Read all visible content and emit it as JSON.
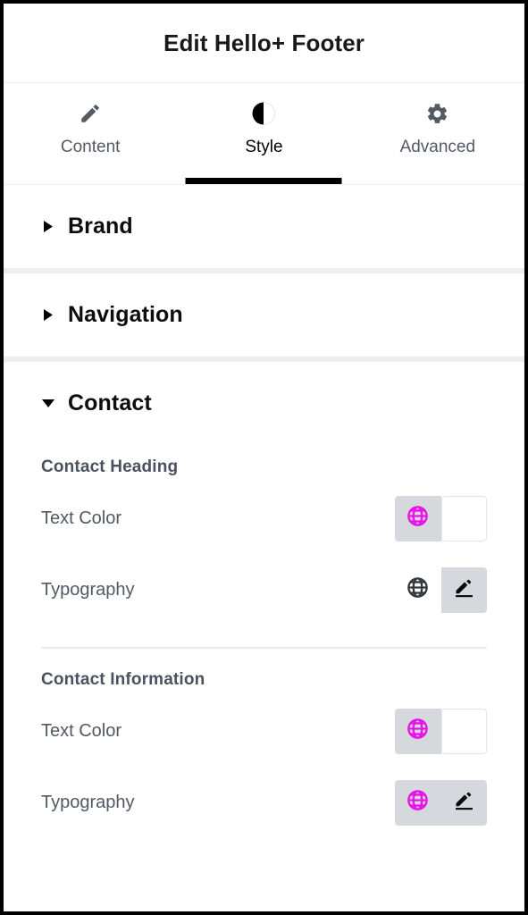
{
  "header": {
    "title": "Edit Hello+ Footer"
  },
  "tabs": [
    {
      "label": "Content",
      "icon": "pencil-icon",
      "active": false
    },
    {
      "label": "Style",
      "icon": "contrast-icon",
      "active": true
    },
    {
      "label": "Advanced",
      "icon": "gear-icon",
      "active": false
    }
  ],
  "sections": [
    {
      "title": "Brand",
      "expanded": false
    },
    {
      "title": "Navigation",
      "expanded": false
    },
    {
      "title": "Contact",
      "expanded": true
    }
  ],
  "contact": {
    "heading_group": {
      "label": "Contact Heading",
      "controls": [
        {
          "label": "Text Color",
          "type": "color",
          "globe_active": true,
          "swatch_color": "#ffffff"
        },
        {
          "label": "Typography",
          "type": "typography",
          "globe_active": false,
          "edit_active": true
        }
      ]
    },
    "information_group": {
      "label": "Contact Information",
      "controls": [
        {
          "label": "Text Color",
          "type": "color",
          "globe_active": true,
          "swatch_color": "#ffffff"
        },
        {
          "label": "Typography",
          "type": "typography",
          "globe_active": true,
          "edit_active": true
        }
      ]
    }
  },
  "colors": {
    "accent_magenta": "#e910e9",
    "control_gray": "#d5d8dc",
    "label_gray": "#515962",
    "sub_label_gray": "#4a5260",
    "separator_gray": "#eceef0",
    "active_black": "#000000"
  }
}
